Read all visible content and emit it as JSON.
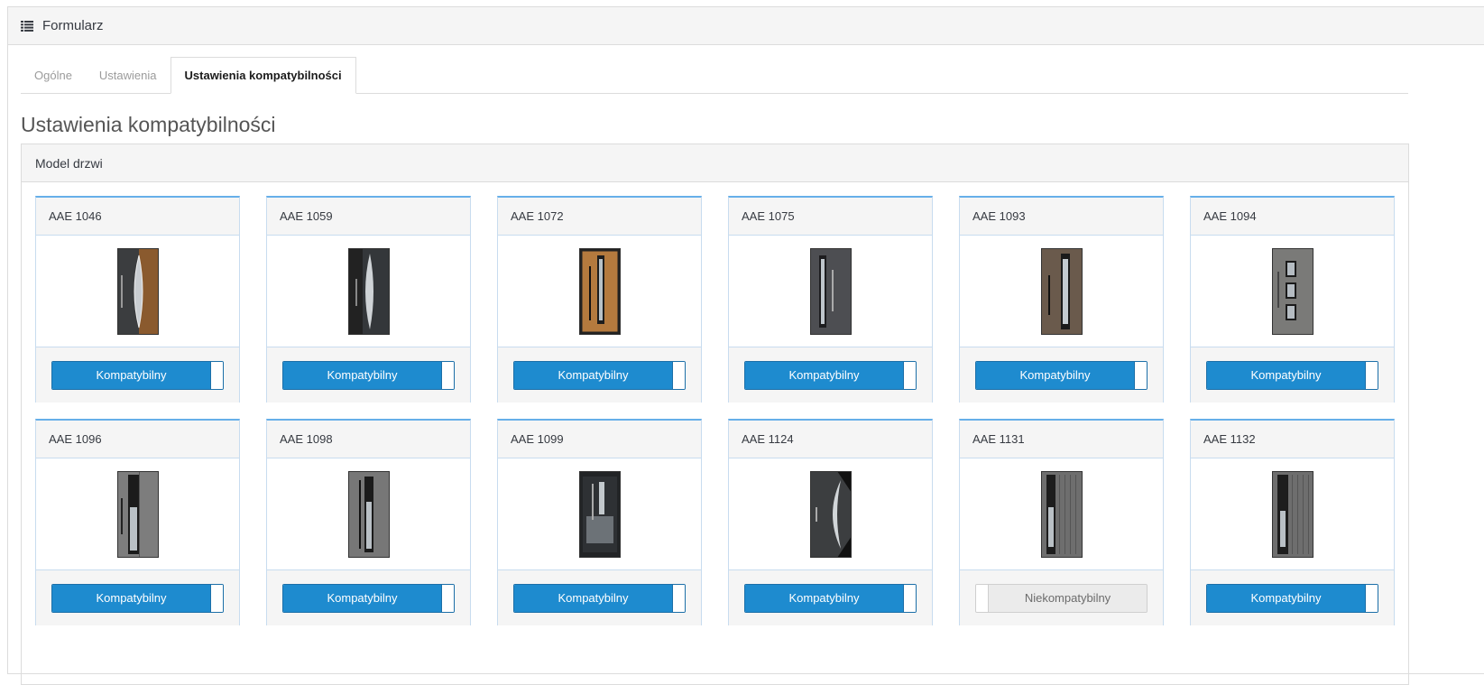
{
  "header": {
    "title": "Formularz",
    "icon": "list-icon"
  },
  "tabs": [
    {
      "label": "Ogólne",
      "active": false
    },
    {
      "label": "Ustawienia",
      "active": false
    },
    {
      "label": "Ustawienia kompatybilności",
      "active": true
    }
  ],
  "page_title": "Ustawienia kompatybilności",
  "section": {
    "title": "Model drzwi"
  },
  "colors": {
    "accent": "#1e8bcf",
    "card_border_top": "#66afe9"
  },
  "cards": [
    {
      "name": "AAE 1046",
      "status": "Kompatybilny",
      "compatible": true
    },
    {
      "name": "AAE 1059",
      "status": "Kompatybilny",
      "compatible": true
    },
    {
      "name": "AAE 1072",
      "status": "Kompatybilny",
      "compatible": true
    },
    {
      "name": "AAE 1075",
      "status": "Kompatybilny",
      "compatible": true
    },
    {
      "name": "AAE 1093",
      "status": "Kompatybilny",
      "compatible": true
    },
    {
      "name": "AAE 1094",
      "status": "Kompatybilny",
      "compatible": true
    },
    {
      "name": "AAE 1096",
      "status": "Kompatybilny",
      "compatible": true
    },
    {
      "name": "AAE 1098",
      "status": "Kompatybilny",
      "compatible": true
    },
    {
      "name": "AAE 1099",
      "status": "Kompatybilny",
      "compatible": true
    },
    {
      "name": "AAE 1124",
      "status": "Kompatybilny",
      "compatible": true
    },
    {
      "name": "AAE 1131",
      "status": "Niekompatybilny",
      "compatible": false
    },
    {
      "name": "AAE 1132",
      "status": "Kompatybilny",
      "compatible": true
    }
  ]
}
